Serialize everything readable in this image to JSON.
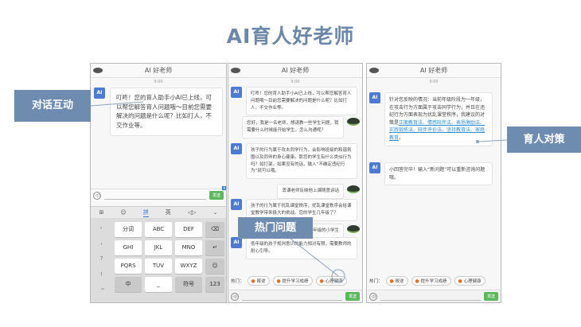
{
  "slide": {
    "title": "AI育人好老师"
  },
  "callouts": {
    "dialog": "对话互动",
    "hot_topics": "热门问题",
    "strategy": "育人对策"
  },
  "phone_common": {
    "title": "AI 好老师",
    "time": "9:00",
    "ai_avatar": "AI",
    "send": "发送",
    "mic": "◁)"
  },
  "phone1": {
    "greeting": "叮咚！您的育人助手小AI已上线，可以帮您解答育人问题哦～目前您需要解决的问题是什么呢？比如打人，不交作业等。",
    "badge": "8",
    "kb_toolbar": [
      "⊞",
      "☺",
      "拼",
      "英",
      "◁▷",
      "⌄"
    ],
    "kb_side": [
      "。",
      "，",
      "？",
      "！",
      "~"
    ],
    "keys": [
      [
        "分词",
        "ABC",
        "DEF",
        "⌫"
      ],
      [
        "GHI",
        "JKL",
        "MNO",
        "↵"
      ],
      [
        "PQRS",
        "TUV",
        "WXYZ",
        "☺"
      ],
      [
        "中",
        "_",
        "符号",
        "123"
      ]
    ]
  },
  "phone2": {
    "greeting": "叮咚！您的育人助手小AI已上线，可以帮您解答育人问题哦～目前您需要解决的问题是什么呢？比如打人，不交作业等。",
    "user1": "您好，我是一名老师，想请教一些学生问题，我需要什么时候能开始学生，怎么沟通呢？",
    "ai2": "孩子的行为属于攻击同学行为，会影响班级的和谐氛围以及同伴的身心健康。那您的学生有什么类似行为吗？如打架，如果没有的话，输入“不确定违纪行为”就可以哦。",
    "user2": "丢课老师反映他上课随意讲话",
    "ai3": "孩子的行为属于扰乱课堂秩序，扰乱课堂秩序会给课堂教学带来极大的挑战。您的学生几年级了？",
    "user3": "一年级的小学生",
    "ai4": "低年级的孩子规则意识的能力相对有限，需要教师的耐心引导。",
    "hot_label": "热门：",
    "hot": [
      "叛逆",
      "提升学习成绩",
      "心理健康"
    ]
  },
  "phone3": {
    "ai1_pre": "针对您反映的情况：当前年级阶段为一年级，在攻击行为方面属于攻击同学行为，并且在违纪行为方面表现为扰乱课堂秩序，我建议的对策是",
    "ai1_links": "正面教育法、情感陪伴法、表扬激励法、实践锻炼法、陪伴评价法、坚持教育法、家庭教育",
    "ai1_end": "。",
    "ai2": "小回答完毕！输入“新问题”可以重新咨询问题哦。",
    "hot_label": "热门：",
    "hot": [
      "叛逆",
      "提升学习成绩",
      "心理健康"
    ]
  },
  "colors": {
    "accent": "#6e8cb0",
    "link": "#2b8ed6",
    "ai_avatar": "#4b7bd4",
    "send": "#5cb85c"
  }
}
